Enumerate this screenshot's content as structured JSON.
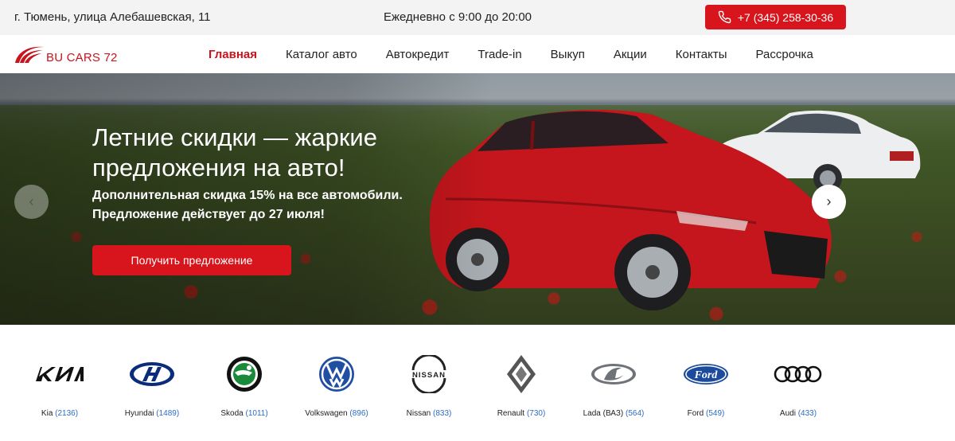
{
  "topbar": {
    "address": "г. Тюмень, улица Алебашевская, 11",
    "hours": "Ежедневно с 9:00 до 20:00",
    "phone": "+7 (345) 258-30-36",
    "phone_icon": "phone-icon"
  },
  "header": {
    "logo_text": "BU CARS 72",
    "nav": [
      {
        "label": "Главная",
        "active": true
      },
      {
        "label": "Каталог авто"
      },
      {
        "label": "Автокредит"
      },
      {
        "label": "Trade-in"
      },
      {
        "label": "Выкуп"
      },
      {
        "label": "Акции"
      },
      {
        "label": "Контакты"
      },
      {
        "label": "Рассрочка"
      }
    ]
  },
  "hero": {
    "title_line1": "Летние скидки — жаркие",
    "title_line2": "предложения на авто!",
    "subtitle_line1": "Дополнительная скидка 15% на все автомобили.",
    "subtitle_line2": "Предложение действует до 27 июля!",
    "cta_label": "Получить предложение",
    "prev_icon": "chevron-left-icon",
    "next_icon": "chevron-right-icon",
    "prev_glyph": "‹",
    "next_glyph": "›"
  },
  "brands": [
    {
      "name": "Kia",
      "count": "(2136)"
    },
    {
      "name": "Hyundai",
      "count": "(1489)"
    },
    {
      "name": "Skoda",
      "count": "(1011)"
    },
    {
      "name": "Volkswagen",
      "count": "(896)"
    },
    {
      "name": "Nissan",
      "count": "(833)"
    },
    {
      "name": "Renault",
      "count": "(730)"
    },
    {
      "name": "Lada (ВАЗ)",
      "count": "(564)"
    },
    {
      "name": "Ford",
      "count": "(549)"
    },
    {
      "name": "Audi",
      "count": "(433)"
    }
  ],
  "colors": {
    "accent": "#d8141c",
    "link": "#2b6cc4",
    "topbar_bg": "#f3f3f4"
  }
}
